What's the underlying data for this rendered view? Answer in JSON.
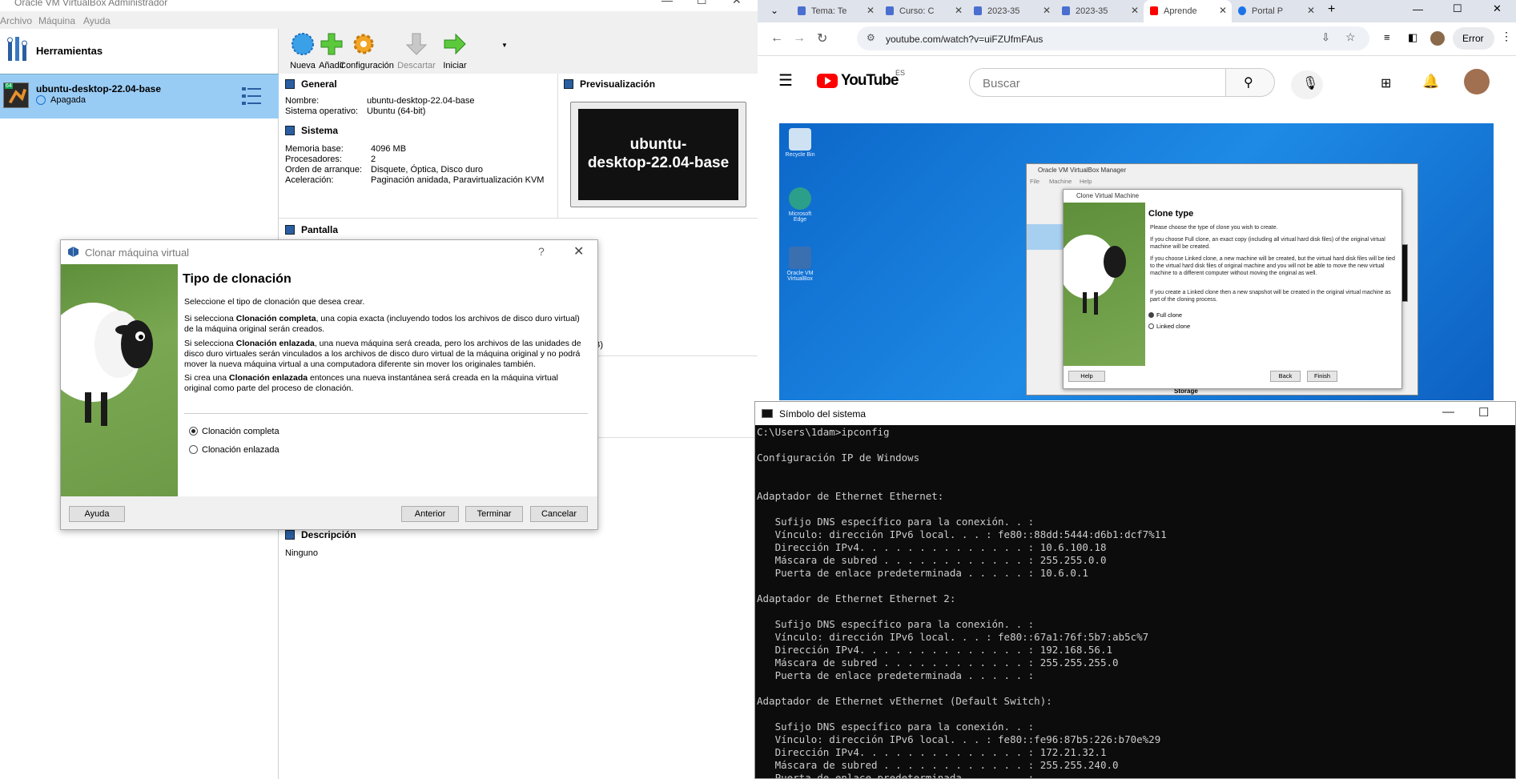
{
  "vbox": {
    "title": "Oracle VM VirtualBox Administrador",
    "menu": [
      "Archivo",
      "Máquina",
      "Ayuda"
    ],
    "tools_label": "Herramientas",
    "vm": {
      "name": "ubuntu-desktop-22.04-base",
      "state": "Apagada",
      "badge": "64"
    },
    "toolbar": {
      "new": "Nueva",
      "add": "Añadir",
      "settings": "Configuración",
      "discard": "Descartar",
      "start": "Iniciar"
    },
    "general": {
      "header": "General",
      "name_label": "Nombre:",
      "name_value": "ubuntu-desktop-22.04-base",
      "os_label": "Sistema operativo:",
      "os_value": "Ubuntu (64-bit)"
    },
    "system": {
      "header": "Sistema",
      "mem_label": "Memoria base:",
      "mem_value": "4096 MB",
      "cpu_label": "Procesadores:",
      "cpu_value": "2",
      "boot_label": "Orden de arranque:",
      "boot_value": "Disquete, Óptica, Disco duro",
      "accel_label": "Aceleración:",
      "accel_value": "Paginación anidada, Paravirtualización KVM"
    },
    "display_header": "Pantalla",
    "preview": {
      "header": "Previsualización",
      "line1": "ubuntu-",
      "line2": "desktop-22.04-base"
    },
    "partial_text": "B)",
    "description": {
      "header": "Descripción",
      "value": "Ninguno"
    }
  },
  "clone_dialog": {
    "title": "Clonar máquina virtual",
    "help_glyph": "?",
    "heading": "Tipo de clonación",
    "p1": "Seleccione el tipo de clonación que desea crear.",
    "p2a": "Si selecciona ",
    "p2b": "Clonación completa",
    "p2c": ", una copia exacta (incluyendo todos los archivos de disco duro virtual) de la máquina original serán creados.",
    "p3a": "Si selecciona ",
    "p3b": "Clonación enlazada",
    "p3c": ", una nueva máquina será creada, pero los archivos de las unidades de disco duro virtuales serán vinculados a los archivos de disco duro virtual de la máquina original y no podrá mover la nueva máquina virtual a una computadora diferente sin mover los originales también.",
    "p4a": "Si crea una ",
    "p4b": "Clonación enlazada",
    "p4c": " entonces una nueva instantánea será creada en la máquina virtual original como parte del proceso de clonación.",
    "option_full": "Clonación completa",
    "option_linked": "Clonación enlazada",
    "selected": "full",
    "btn_help": "Ayuda",
    "btn_back": "Anterior",
    "btn_finish": "Terminar",
    "btn_cancel": "Cancelar"
  },
  "chrome": {
    "tabs": [
      {
        "title": "Tema: Te",
        "active": false
      },
      {
        "title": "Curso: C",
        "active": false
      },
      {
        "title": "2023-35",
        "active": false
      },
      {
        "title": "2023-35",
        "active": false
      },
      {
        "title": "Aprende",
        "active": true
      },
      {
        "title": "Portal P",
        "active": false
      }
    ],
    "url": "youtube.com/watch?v=uiFZUfmFAus",
    "error_label": "Error",
    "youtube": {
      "logo": "YouTube",
      "region": "ES",
      "search_placeholder": "Buscar"
    },
    "video": {
      "desktop_icons": [
        "Recycle Bin",
        "Microsoft Edge",
        "Oracle VM VirtualBox"
      ],
      "vb_title": "Oracle VM VirtualBox Manager",
      "vb_menu": [
        "File",
        "Machine",
        "Help"
      ],
      "clone_title": "Clone Virtual Machine",
      "clone_heading": "Clone type",
      "l1": "Please choose the type of clone you wish to create.",
      "l2": "If you choose Full clone, an exact copy (including all virtual hard disk files) of the original virtual machine will be created.",
      "l3": "If you choose Linked clone, a new machine will be created, but the virtual hard disk files will be tied to the virtual hard disk files of original machine and you will not be able to move the new virtual machine to a different computer without moving the original as well.",
      "l4": "If you create a Linked clone then a new snapshot will be created in the original virtual machine as part of the cloning process.",
      "opt_full": "Full clone",
      "opt_linked": "Linked clone",
      "btn_help": "Help",
      "btn_back": "Back",
      "btn_finish": "Finish",
      "storage": "Storage"
    }
  },
  "cmd": {
    "title": "Símbolo del sistema",
    "lines": [
      "C:\\Users\\1dam>ipconfig",
      "",
      "Configuración IP de Windows",
      "",
      "",
      "Adaptador de Ethernet Ethernet:",
      "",
      "   Sufijo DNS específico para la conexión. . :",
      "   Vínculo: dirección IPv6 local. . . : fe80::88dd:5444:d6b1:dcf7%11",
      "   Dirección IPv4. . . . . . . . . . . . . . : 10.6.100.18",
      "   Máscara de subred . . . . . . . . . . . . : 255.255.0.0",
      "   Puerta de enlace predeterminada . . . . . : 10.6.0.1",
      "",
      "Adaptador de Ethernet Ethernet 2:",
      "",
      "   Sufijo DNS específico para la conexión. . :",
      "   Vínculo: dirección IPv6 local. . . : fe80::67a1:76f:5b7:ab5c%7",
      "   Dirección IPv4. . . . . . . . . . . . . . : 192.168.56.1",
      "   Máscara de subred . . . . . . . . . . . . : 255.255.255.0",
      "   Puerta de enlace predeterminada . . . . . :",
      "",
      "Adaptador de Ethernet vEthernet (Default Switch):",
      "",
      "   Sufijo DNS específico para la conexión. . :",
      "   Vínculo: dirección IPv6 local. . . : fe80::fe96:87b5:226:b70e%29",
      "   Dirección IPv4. . . . . . . . . . . . . . : 172.21.32.1",
      "   Máscara de subred . . . . . . . . . . . . : 255.255.240.0",
      "   Puerta de enlace predeterminada . . . . . :"
    ]
  }
}
